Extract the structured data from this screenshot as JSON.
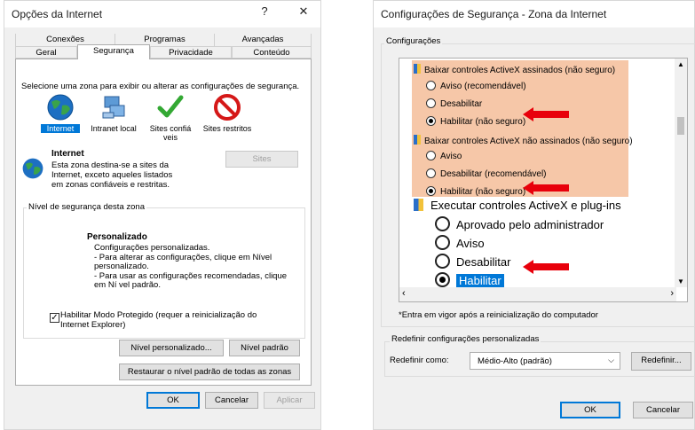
{
  "left": {
    "title": "Opções da Internet",
    "help_glyph": "?",
    "close_glyph": "✕",
    "tabs_row1": [
      "Conexões",
      "Programas",
      "Avançadas"
    ],
    "tabs_row2": [
      "Geral",
      "Segurança",
      "Privacidade",
      "Conteúdo"
    ],
    "zone_prompt": "Selecione uma zona para exibir ou alterar as configurações de segurança.",
    "zones": [
      {
        "label": "Internet",
        "icon": "globe-icon"
      },
      {
        "label": "Intranet local",
        "icon": "network-icon"
      },
      {
        "label": "Sites confiá veis",
        "icon": "checkmark-icon"
      },
      {
        "label": "Sites restritos",
        "icon": "no-entry-icon"
      }
    ],
    "zone_title": "Internet",
    "zone_desc": "Esta zona destina-se a sites da Internet, exceto aqueles listados em zonas confiáveis e restritas.",
    "sites_button": "Sites",
    "level_group": "Nível de segurança desta zona",
    "custom_title": "Personalizado",
    "custom_lines": [
      "Configurações personalizadas.",
      "- Para alterar as configurações, clique em Nível personalizado.",
      "- Para usar as configurações recomendadas, clique em Ní vel padrão."
    ],
    "protected_mode": "Habilitar Modo Protegido (requer a reinicialização do Internet Explorer)",
    "custom_level_button": "Nível personalizado...",
    "default_level_button": "Nível padrão",
    "reset_all_button": "Restaurar o nível padrão de todas as zonas",
    "ok": "OK",
    "cancel": "Cancelar",
    "apply": "Aplicar"
  },
  "right": {
    "title": "Configurações de Segurança - Zona da Internet",
    "settings_group": "Configurações",
    "items": [
      {
        "heading": "Baixar controles ActiveX assinados (não seguro)",
        "options": [
          {
            "label": "Aviso (recomendável)",
            "checked": false
          },
          {
            "label": "Desabilitar",
            "checked": false
          },
          {
            "label": "Habilitar (não seguro)",
            "checked": true
          }
        ]
      },
      {
        "heading": "Baixar controles ActiveX não assinados (não seguro)",
        "options": [
          {
            "label": "Aviso",
            "checked": false
          },
          {
            "label": "Desabilitar (recomendável)",
            "checked": false
          },
          {
            "label": "Habilitar (não seguro)",
            "checked": true
          }
        ]
      },
      {
        "heading": "Executar controles ActiveX e plug-ins",
        "options": [
          {
            "label": "Aprovado pelo administrador",
            "checked": false
          },
          {
            "label": "Aviso",
            "checked": false
          },
          {
            "label": "Desabilitar",
            "checked": false
          },
          {
            "label": "Habilitar",
            "checked": true
          }
        ]
      }
    ],
    "note": "*Entra em vigor após a reinicialização do computador",
    "reset_group": "Redefinir configurações personalizadas",
    "reset_as_label": "Redefinir como:",
    "reset_select_value": "Médio-Alto (padrão)",
    "reset_button": "Redefinir...",
    "ok": "OK",
    "cancel": "Cancelar"
  },
  "colors": {
    "highlight_block": "#f6c7a8",
    "arrow_red": "#e8000b",
    "selection_blue": "#0078d7",
    "accent_blue": "#0078d7"
  }
}
